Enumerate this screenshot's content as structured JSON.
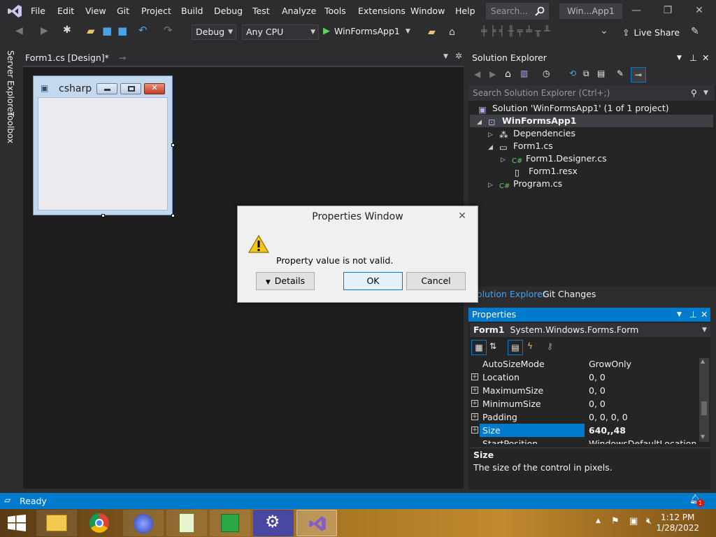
{
  "menu": {
    "items": [
      "File",
      "Edit",
      "View",
      "Git",
      "Project",
      "Build",
      "Debug",
      "Test",
      "Analyze",
      "Tools",
      "Extensions",
      "Window",
      "Help"
    ],
    "search_placeholder": "Search...",
    "window_title": "Win...App1"
  },
  "toolbar": {
    "configuration": "Debug",
    "platform": "Any CPU",
    "start_target": "WinFormsApp1",
    "live_share": "Live Share"
  },
  "left_rail": {
    "server_explorer": "Server Explorer",
    "toolbox": "Toolbox"
  },
  "document": {
    "tab_label": "Form1.cs [Design]*",
    "form_caption": "csharp"
  },
  "solution_explorer": {
    "title": "Solution Explorer",
    "search_placeholder": "Search Solution Explorer (Ctrl+;)",
    "tree": {
      "solution": "Solution 'WinFormsApp1' (1 of 1 project)",
      "project": "WinFormsApp1",
      "dependencies": "Dependencies",
      "form1": "Form1.cs",
      "designer": "Form1.Designer.cs",
      "resx": "Form1.resx",
      "program": "Program.cs"
    },
    "tabs": [
      "Solution Explorer",
      "Git Changes"
    ]
  },
  "properties": {
    "title": "Properties",
    "object_name": "Form1",
    "object_type": "System.Windows.Forms.Form",
    "rows": [
      {
        "name": "AutoSizeMode",
        "value": "GrowOnly"
      },
      {
        "name": "Location",
        "value": "0, 0"
      },
      {
        "name": "MaximumSize",
        "value": "0, 0"
      },
      {
        "name": "MinimumSize",
        "value": "0, 0"
      },
      {
        "name": "Padding",
        "value": "0, 0, 0, 0"
      },
      {
        "name": "Size",
        "value": "640,,48"
      },
      {
        "name": "StartPosition",
        "value": "WindowsDefaultLocation"
      }
    ],
    "description_title": "Size",
    "description_text": "The size of the control in pixels."
  },
  "dialog": {
    "title": "Properties Window",
    "message": "Property value is not valid.",
    "details_label": "Details",
    "ok_label": "OK",
    "cancel_label": "Cancel"
  },
  "status": {
    "text": "Ready",
    "notification_count": "1"
  },
  "taskbar": {
    "time": "1:12 PM",
    "date": "1/28/2022"
  },
  "colors": {
    "accent": "#007acc",
    "editor_bg": "#1e1e1e",
    "chrome_bg": "#2d2d30",
    "vs_purple": "#865fc5"
  }
}
